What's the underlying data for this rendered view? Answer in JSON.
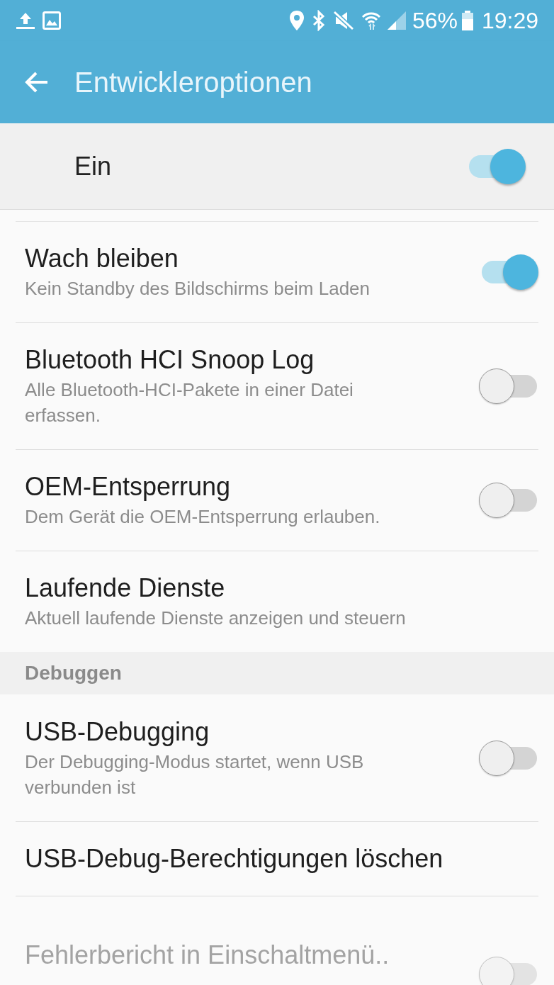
{
  "status_bar": {
    "battery": "56%",
    "time": "19:29"
  },
  "app_bar": {
    "title": "Entwickleroptionen"
  },
  "master": {
    "label": "Ein",
    "on": true
  },
  "items": [
    {
      "kind": "toggle",
      "title": "Wach bleiben",
      "subtitle": "Kein Standby des Bildschirms beim Laden",
      "on": true,
      "disabled": false
    },
    {
      "kind": "toggle",
      "title": "Bluetooth HCI Snoop Log",
      "subtitle": "Alle Bluetooth-HCI-Pakete in einer Datei erfassen.",
      "on": false,
      "disabled": false
    },
    {
      "kind": "toggle",
      "title": "OEM-Entsperrung",
      "subtitle": "Dem Gerät die OEM-Entsperrung erlauben.",
      "on": false,
      "disabled": false
    },
    {
      "kind": "plain",
      "title": "Laufende Dienste",
      "subtitle": "Aktuell laufende Dienste anzeigen und steuern",
      "disabled": false
    },
    {
      "kind": "header",
      "title": "Debuggen"
    },
    {
      "kind": "toggle",
      "title": "USB-Debugging",
      "subtitle": "Der Debugging-Modus startet, wenn USB verbunden ist",
      "on": false,
      "disabled": false
    },
    {
      "kind": "plain",
      "title": "USB-Debug-Berechtigungen löschen",
      "disabled": false
    },
    {
      "kind": "toggle",
      "title": "Fehlerbericht in Einschaltmenü..",
      "on": false,
      "disabled": true
    }
  ]
}
